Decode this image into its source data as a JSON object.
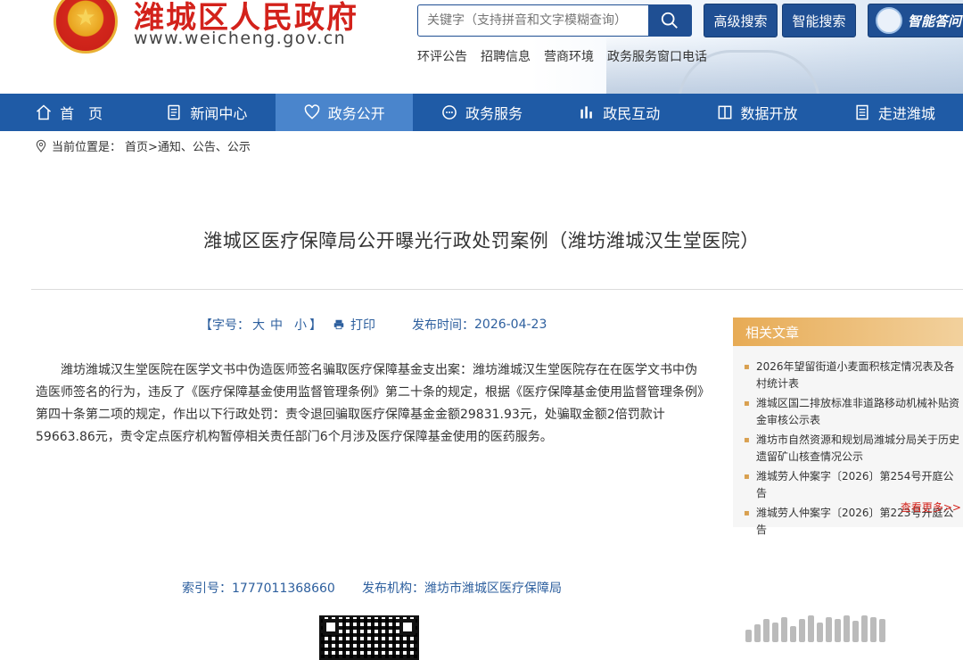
{
  "header": {
    "site_name": "潍城区人民政府",
    "site_url": "www.weicheng.gov.cn",
    "search": {
      "placeholder": "关键字（支持拼音和文字模糊查询）"
    },
    "buttons": {
      "advanced": "高级搜索",
      "smart": "智能搜索",
      "ai": "智能答问"
    },
    "quick_links": [
      "环评公告",
      "招聘信息",
      "营商环境",
      "政务服务窗口电话"
    ]
  },
  "nav": {
    "items": [
      {
        "label": "首　页",
        "icon": "home-icon"
      },
      {
        "label": "新闻中心",
        "icon": "document-icon"
      },
      {
        "label": "政务公开",
        "icon": "heart-icon"
      },
      {
        "label": "政务服务",
        "icon": "chat-icon"
      },
      {
        "label": "政民互动",
        "icon": "bar-chart-icon"
      },
      {
        "label": "数据开放",
        "icon": "panel-icon"
      },
      {
        "label": "走进潍城",
        "icon": "building-icon"
      }
    ],
    "active_index": 2
  },
  "breadcrumb": {
    "prefix": "当前位置是：",
    "path": "首页>通知、公告、公示"
  },
  "article": {
    "title": "潍城区医疗保障局公开曝光行政处罚案例（潍坊潍城汉生堂医院）",
    "font_size_label": "【字号：",
    "font_sizes": [
      "大",
      "中",
      "小"
    ],
    "font_size_close": "】",
    "print_label": "打印",
    "publish_label": "发布时间：",
    "publish_date": "2026-04-23",
    "body": "潍坊潍城汉生堂医院在医学文书中伪造医师签名骗取医疗保障基金支出案：潍坊潍城汉生堂医院存在在医学文书中伪造医师签名的行为，违反了《医疗保障基金使用监督管理条例》第二十条的规定，根据《医疗保障基金使用监督管理条例》第四十条第二项的规定，作出以下行政处罚：责令退回骗取医疗保障基金金额29831.93元，处骗取金额2倍罚款计59663.86元，责令定点医疗机构暂停相关责任部门6个月涉及医疗保障基金使用的医药服务。",
    "index_label": "索引号：",
    "index_value": "1777011368660",
    "org_label": "发布机构：",
    "org_value": "潍坊市潍城区医疗保障局"
  },
  "related": {
    "title": "相关文章",
    "items": [
      "2026年望留街道小麦面积核定情况表及各村统计表",
      "潍城区国二排放标准非道路移动机械补贴资金审核公示表",
      "潍坊市自然资源和规划局潍城分局关于历史遗留矿山核查情况公示",
      "潍城劳人仲案字〔2026〕第254号开庭公告",
      "潍城劳人仲案字〔2026〕第223号开庭公告"
    ],
    "more": "查看更多>>"
  },
  "colors": {
    "primary": "#1f5ba6",
    "accent_red": "#d3221b",
    "gold": "#e7ab55"
  }
}
